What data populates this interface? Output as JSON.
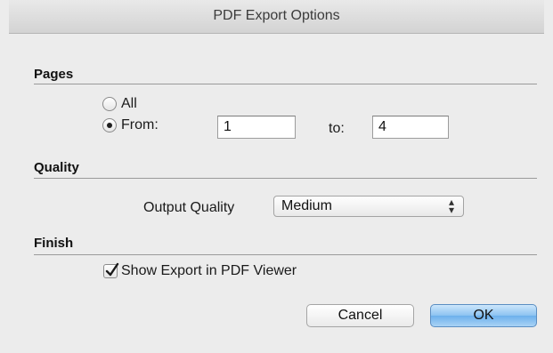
{
  "window": {
    "title": "PDF Export Options"
  },
  "pages": {
    "heading": "Pages",
    "option_all": "All",
    "option_from": "From:",
    "selected": "From:",
    "from_value": "1",
    "to_label": "to:",
    "to_value": "4"
  },
  "quality": {
    "heading": "Quality",
    "output_label": "Output Quality",
    "selected_value": "Medium"
  },
  "finish": {
    "heading": "Finish",
    "show_export_label": "Show Export in PDF Viewer",
    "show_export_checked": true
  },
  "buttons": {
    "cancel": "Cancel",
    "ok": "OK"
  },
  "icons": {
    "radio_selected": "radio-selected-icon",
    "checkmark": "checkmark-icon",
    "select_arrows": "up-down-chevron-icon"
  },
  "colors": {
    "ok_button": "#8cc2f1",
    "background": "#ececec"
  }
}
